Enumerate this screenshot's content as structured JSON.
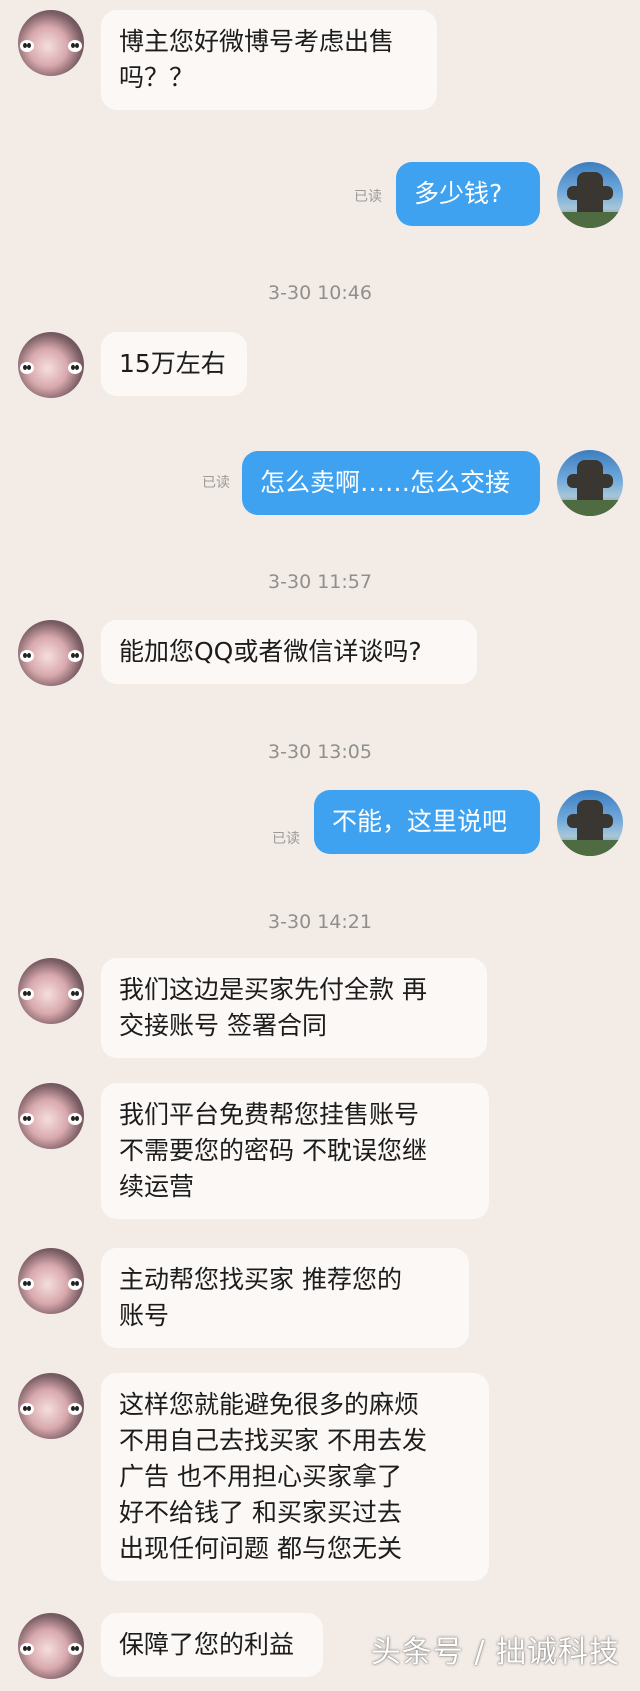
{
  "conversation": {
    "messages": [
      {
        "from": "them",
        "text": "博主您好微博号考虑出售\n吗？？"
      },
      {
        "from": "me",
        "text": "多少钱?",
        "read": "已读"
      },
      {
        "from": "time",
        "text": "3-30 10:46"
      },
      {
        "from": "them",
        "text": "15万左右"
      },
      {
        "from": "me",
        "text": "怎么卖啊……怎么交接",
        "read": "已读"
      },
      {
        "from": "time",
        "text": "3-30 11:57"
      },
      {
        "from": "them",
        "text": "能加您QQ或者微信详谈吗?"
      },
      {
        "from": "time",
        "text": "3-30 13:05"
      },
      {
        "from": "me",
        "text": "不能，这里说吧",
        "read": "已读"
      },
      {
        "from": "time",
        "text": "3-30 14:21"
      },
      {
        "from": "them",
        "text": "我们这边是买家先付全款    再\n交接账号    签署合同"
      },
      {
        "from": "them",
        "text": "我们平台免费帮您挂售账号\n不需要您的密码    不耽误您继\n续运营"
      },
      {
        "from": "them",
        "text": "主动帮您找买家      推荐您的\n账号"
      },
      {
        "from": "them",
        "text": "这样您就能避免很多的麻烦\n不用自己去找买家    不用去发\n广告      也不用担心买家拿了\n好不给钱了        和买家买过去\n出现任何问题   都与您无关"
      },
      {
        "from": "them",
        "text": "保障了您的利益"
      }
    ]
  },
  "watermark": {
    "text": "头条号 / 拙诚科技"
  },
  "colors": {
    "background": "#f3ece6",
    "incoming_bubble": "#fbf8f6",
    "outgoing_bubble": "#3ea2f1"
  },
  "icons": {
    "them_avatar": "user-avatar-icon",
    "me_avatar": "robot-avatar-icon"
  }
}
